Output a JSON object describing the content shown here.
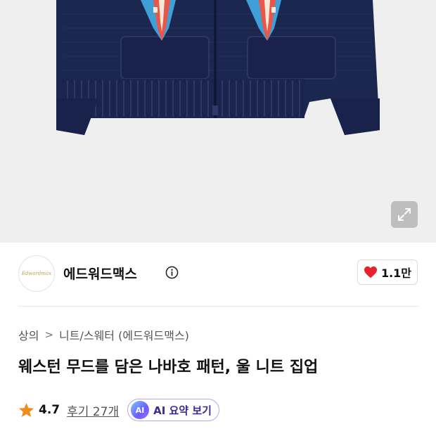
{
  "product_image": {
    "alt": "navy Navajo-pattern wool knit zip-up"
  },
  "icons": {
    "expand": "expand-icon",
    "info": "info-icon",
    "heart": "heart-icon",
    "star": "star-icon"
  },
  "brand": {
    "logo_text": "Edwardmax",
    "name": "에드워드맥스",
    "likes": "1.1만"
  },
  "breadcrumb": {
    "items": [
      "상의",
      "니트/스웨터 (에드워드맥스)"
    ],
    "separator": ">"
  },
  "product": {
    "title": "웨스턴 무드를 담은 나바호 패턴, 울 니트 집업",
    "rating": "4.7",
    "reviews_label": "후기 27개",
    "ai_badge": "AI",
    "ai_summary_label": "AI 요약 보기"
  },
  "colors": {
    "accent_heart": "#e8212c",
    "star": "#f08c1a",
    "knit_navy": "#1b2549"
  }
}
